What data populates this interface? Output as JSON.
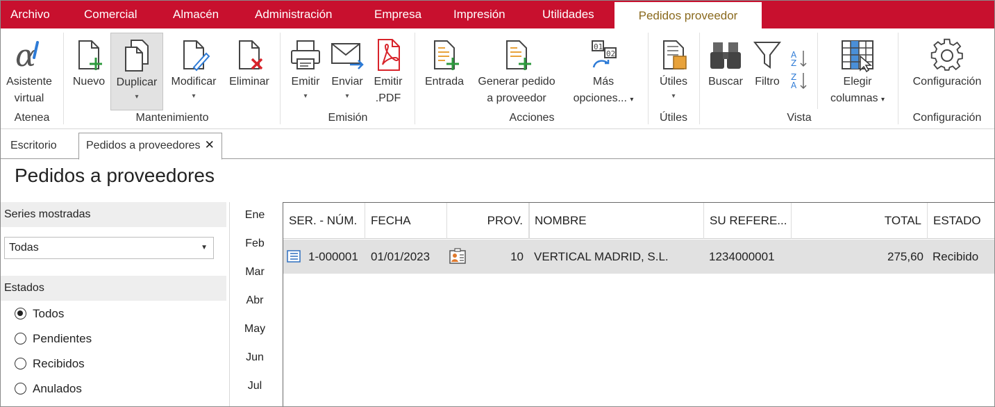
{
  "menu": {
    "items": [
      "Archivo",
      "Comercial",
      "Almacén",
      "Administración",
      "Empresa",
      "Impresión",
      "Utilidades"
    ],
    "active": "Pedidos proveedor"
  },
  "ribbon": {
    "buttons": {
      "asistente": [
        "Asistente",
        "virtual"
      ],
      "nuevo": "Nuevo",
      "duplicar": "Duplicar",
      "modificar": "Modificar",
      "eliminar": "Eliminar",
      "emitir": "Emitir",
      "enviar": "Enviar",
      "emitir_pdf": [
        "Emitir",
        ".PDF"
      ],
      "entrada": "Entrada",
      "generar": [
        "Generar pedido",
        "a proveedor"
      ],
      "mas": [
        "Más",
        "opciones..."
      ],
      "utiles": "Útiles",
      "buscar": "Buscar",
      "filtro": "Filtro",
      "elegir": [
        "Elegir",
        "columnas"
      ],
      "configuracion": "Configuración"
    },
    "groups": {
      "atenea": "Atenea",
      "mantenimiento": "Mantenimiento",
      "emision": "Emisión",
      "acciones": "Acciones",
      "utiles": "Útiles",
      "vista": "Vista",
      "configuracion": "Configuración"
    },
    "dropdown_glyph": "▾"
  },
  "tabs": {
    "escritorio": "Escritorio",
    "pedidos": "Pedidos a proveedores",
    "close": "✕"
  },
  "page_title": "Pedidos a proveedores",
  "left_panel": {
    "series_label": "Series mostradas",
    "series_value": "Todas",
    "estados_label": "Estados",
    "estados": [
      "Todos",
      "Pendientes",
      "Recibidos",
      "Anulados"
    ],
    "selected_estado": "Todos"
  },
  "months": [
    "Ene",
    "Feb",
    "Mar",
    "Abr",
    "May",
    "Jun",
    "Jul"
  ],
  "grid": {
    "columns": [
      "SER. - NÚM.",
      "FECHA",
      "",
      "PROV.",
      "NOMBRE",
      "SU REFERE...",
      "TOTAL",
      "ESTADO"
    ],
    "rows": [
      {
        "num": "1-000001",
        "fecha": "01/01/2023",
        "prov": "10",
        "nombre": "VERTICAL MADRID, S.L.",
        "referencia": "1234000001",
        "total": "275,60",
        "estado": "Recibido"
      }
    ]
  },
  "colors": {
    "menubar": "#c8102e",
    "active_menu_text": "#8a6a1e",
    "row_selected": "#e1e1e1"
  }
}
